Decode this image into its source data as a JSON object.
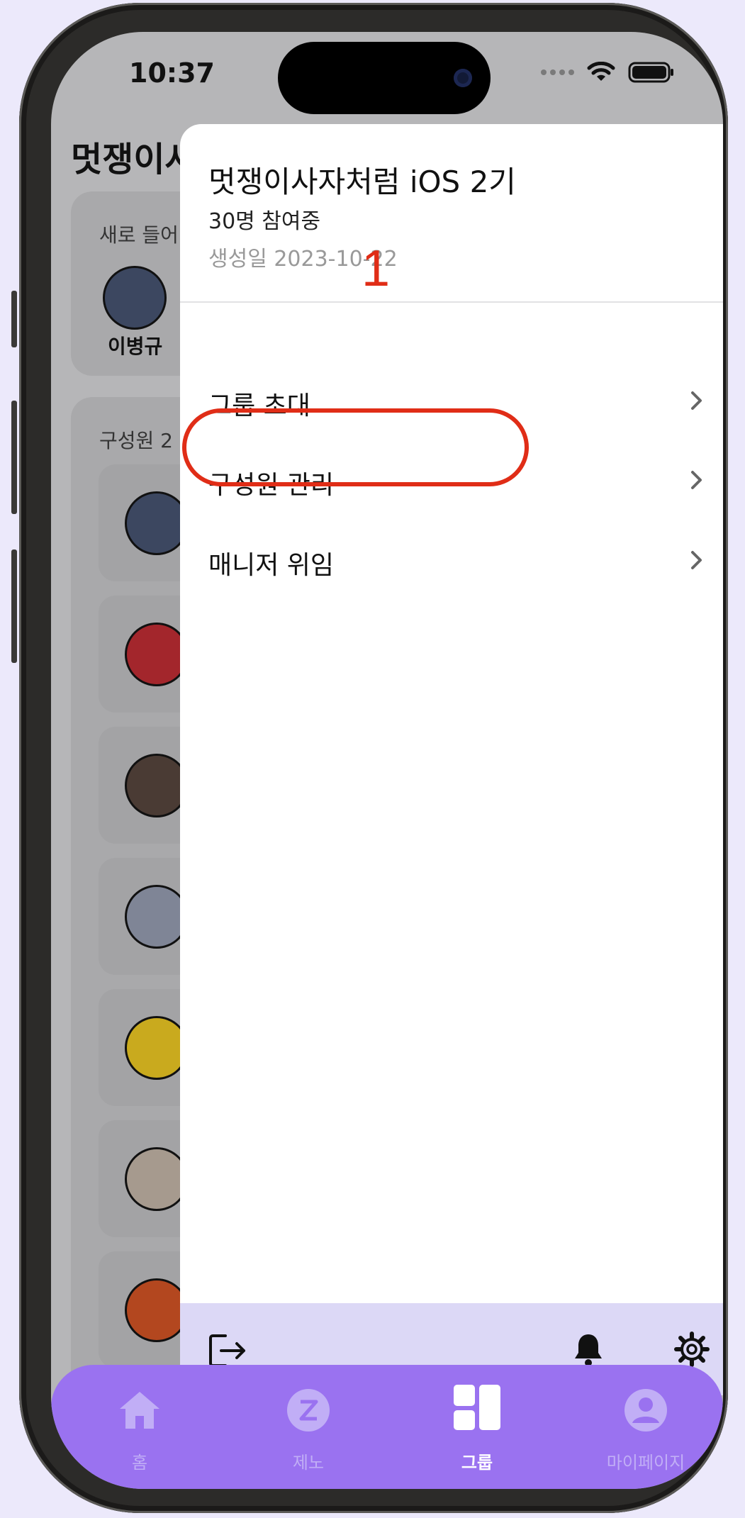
{
  "status_bar": {
    "time": "10:37"
  },
  "background": {
    "title": "멋쟁이사",
    "new_members_label": "새로 들어",
    "new_member_name": "이병규",
    "members_label": "구성원 2"
  },
  "sheet": {
    "group_name": "멋쟁이사자처럼 iOS 2기",
    "participant_count": "30명 참여중",
    "created_date": "생성일 2023-10-22",
    "menu": [
      {
        "label": "그룹 초대"
      },
      {
        "label": "구성원 관리"
      },
      {
        "label": "매니저 위임"
      }
    ]
  },
  "annotation": {
    "step_number": "1",
    "color": "#e02d17"
  },
  "tab_bar": {
    "tabs": [
      {
        "label": "홈",
        "icon": "home-icon"
      },
      {
        "label": "제노",
        "icon": "zeno-icon"
      },
      {
        "label": "그룹",
        "icon": "group-icon"
      },
      {
        "label": "마이페이지",
        "icon": "profile-icon"
      }
    ],
    "active_tab": "그룹",
    "accent_color": "#9a72f0"
  }
}
